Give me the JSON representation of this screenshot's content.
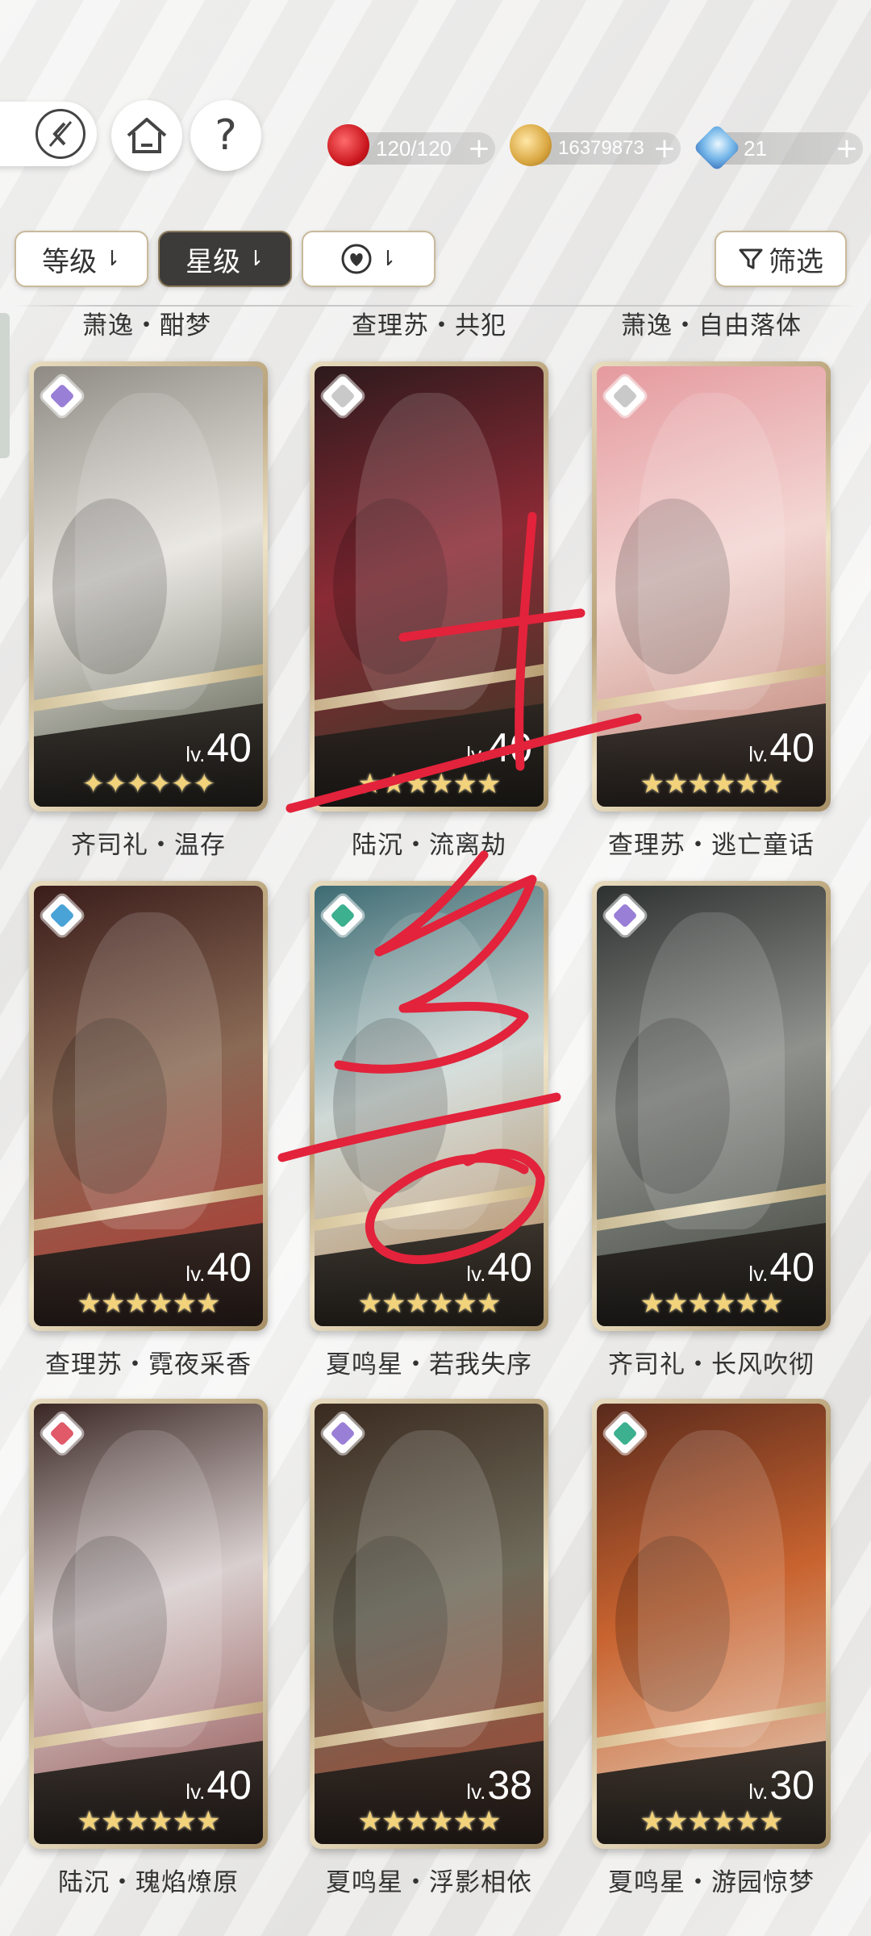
{
  "nav": {
    "back_icon": "back-arrow-icon",
    "home_icon": "home-icon",
    "help_label": "?"
  },
  "resources": [
    {
      "name": "stamina",
      "icon": "apple-icon",
      "value": "120/120",
      "plus": "+"
    },
    {
      "name": "gold",
      "icon": "coin-icon",
      "value": "16379873",
      "plus": "+"
    },
    {
      "name": "gem",
      "icon": "gem-icon",
      "value": "21",
      "plus": "+"
    }
  ],
  "filters": {
    "level_label": "等级",
    "star_label": "星级",
    "heart_icon": "heart-icon",
    "sort_arrow": "⇂",
    "screen_label": "筛选"
  },
  "header_titles": [
    "萧逸・酣梦",
    "查理苏・共犯",
    "萧逸・自由落体"
  ],
  "cards": [
    {
      "title": "齐司礼・温存",
      "lv_label": "lv.",
      "level": "40",
      "stars": "✦✦✦✦✦✦",
      "badge_color": "#9a7fd6",
      "art": [
        "#8f8b84",
        "#e7e4df",
        "#4a4f3d"
      ]
    },
    {
      "title": "陆沉・流离劫",
      "lv_label": "lv.",
      "level": "40",
      "stars": "★★★★★★",
      "badge_color": "#c9c9c9",
      "art": [
        "#2d1a1c",
        "#8a2a35",
        "#2f3a24"
      ]
    },
    {
      "title": "查理苏・逃亡童话",
      "lv_label": "lv.",
      "level": "40",
      "stars": "★★★★★★",
      "badge_color": "#c9c9c9",
      "art": [
        "#e59a9f",
        "#f3d6d3",
        "#b97d6d"
      ]
    },
    {
      "title": "查理苏・霓夜采香",
      "lv_label": "lv.",
      "level": "40",
      "stars": "★★★★★★",
      "badge_color": "#4aa3d6",
      "art": [
        "#3a1c1a",
        "#8a6a55",
        "#b5322d"
      ]
    },
    {
      "title": "夏鸣星・若我失序",
      "lv_label": "lv.",
      "level": "40",
      "stars": "★★★★★★",
      "badge_color": "#3db08f",
      "art": [
        "#3d6b73",
        "#cfd9d6",
        "#b58454"
      ]
    },
    {
      "title": "齐司礼・长风吹彻",
      "lv_label": "lv.",
      "level": "40",
      "stars": "★★★★★★",
      "badge_color": "#9a7fd6",
      "art": [
        "#2d3130",
        "#8e918c",
        "#3b4038"
      ]
    },
    {
      "title": "陆沉・瑰焰燎原",
      "lv_label": "lv.",
      "level": "40",
      "stars": "★★★★★★",
      "badge_color": "#e05a6a",
      "art": [
        "#3a2724",
        "#d9cfcf",
        "#8e4a48"
      ]
    },
    {
      "title": "夏鸣星・浮影相依",
      "lv_label": "lv.",
      "level": "38",
      "stars": "★★★★★★",
      "badge_color": "#9a7fd6",
      "art": [
        "#3a2a1f",
        "#6e6a5a",
        "#a8432d"
      ]
    },
    {
      "title": "夏鸣星・游园惊梦",
      "lv_label": "lv.",
      "level": "30",
      "stars": "★★★★★★",
      "badge_color": "#3db08f",
      "art": [
        "#5a2a1c",
        "#c8632f",
        "#e8d8c8"
      ]
    }
  ],
  "scribble_color": "#e2233b"
}
